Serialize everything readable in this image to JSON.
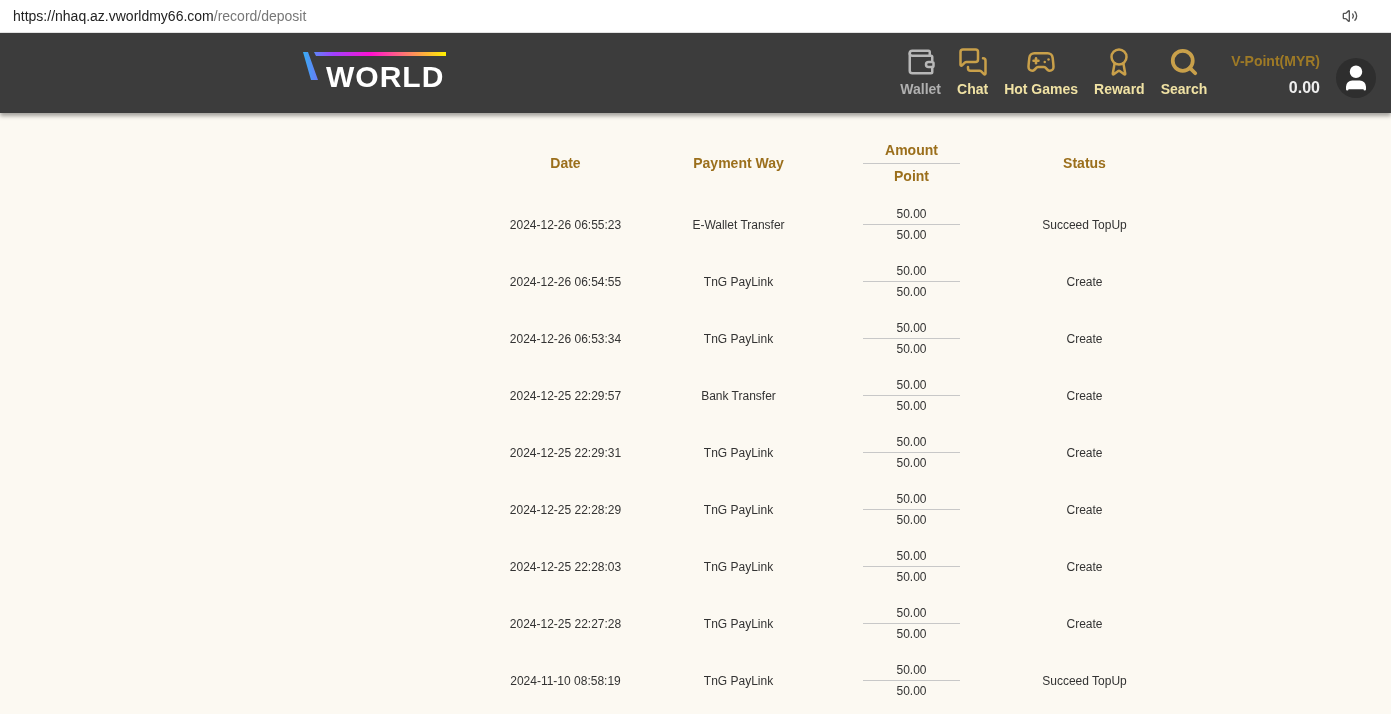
{
  "browser": {
    "url_host": "https://nhaq.az.vworldmy66.com",
    "url_path": "/record/deposit"
  },
  "header": {
    "logo_text": "WORLD",
    "nav": [
      {
        "label": "Wallet",
        "kind": "wallet",
        "muted": true
      },
      {
        "label": "Chat",
        "kind": "chat",
        "muted": false
      },
      {
        "label": "Hot Games",
        "kind": "games",
        "muted": false
      },
      {
        "label": "Reward",
        "kind": "reward",
        "muted": false
      },
      {
        "label": "Search",
        "kind": "search",
        "muted": false
      }
    ],
    "points_label": "V-Point(MYR)",
    "points_value": "0.00"
  },
  "table": {
    "columns": [
      "Date",
      "Payment Way",
      "Amount",
      "Point",
      "Status"
    ],
    "rows": [
      {
        "date": "2024-12-26 06:55:23",
        "payment_way": "E-Wallet Transfer",
        "amount": "50.00",
        "point": "50.00",
        "status": "Succeed TopUp"
      },
      {
        "date": "2024-12-26 06:54:55",
        "payment_way": "TnG PayLink",
        "amount": "50.00",
        "point": "50.00",
        "status": "Create"
      },
      {
        "date": "2024-12-26 06:53:34",
        "payment_way": "TnG PayLink",
        "amount": "50.00",
        "point": "50.00",
        "status": "Create"
      },
      {
        "date": "2024-12-25 22:29:57",
        "payment_way": "Bank Transfer",
        "amount": "50.00",
        "point": "50.00",
        "status": "Create"
      },
      {
        "date": "2024-12-25 22:29:31",
        "payment_way": "TnG PayLink",
        "amount": "50.00",
        "point": "50.00",
        "status": "Create"
      },
      {
        "date": "2024-12-25 22:28:29",
        "payment_way": "TnG PayLink",
        "amount": "50.00",
        "point": "50.00",
        "status": "Create"
      },
      {
        "date": "2024-12-25 22:28:03",
        "payment_way": "TnG PayLink",
        "amount": "50.00",
        "point": "50.00",
        "status": "Create"
      },
      {
        "date": "2024-12-25 22:27:28",
        "payment_way": "TnG PayLink",
        "amount": "50.00",
        "point": "50.00",
        "status": "Create"
      },
      {
        "date": "2024-11-10 08:58:19",
        "payment_way": "TnG PayLink",
        "amount": "50.00",
        "point": "50.00",
        "status": "Succeed TopUp"
      }
    ]
  }
}
